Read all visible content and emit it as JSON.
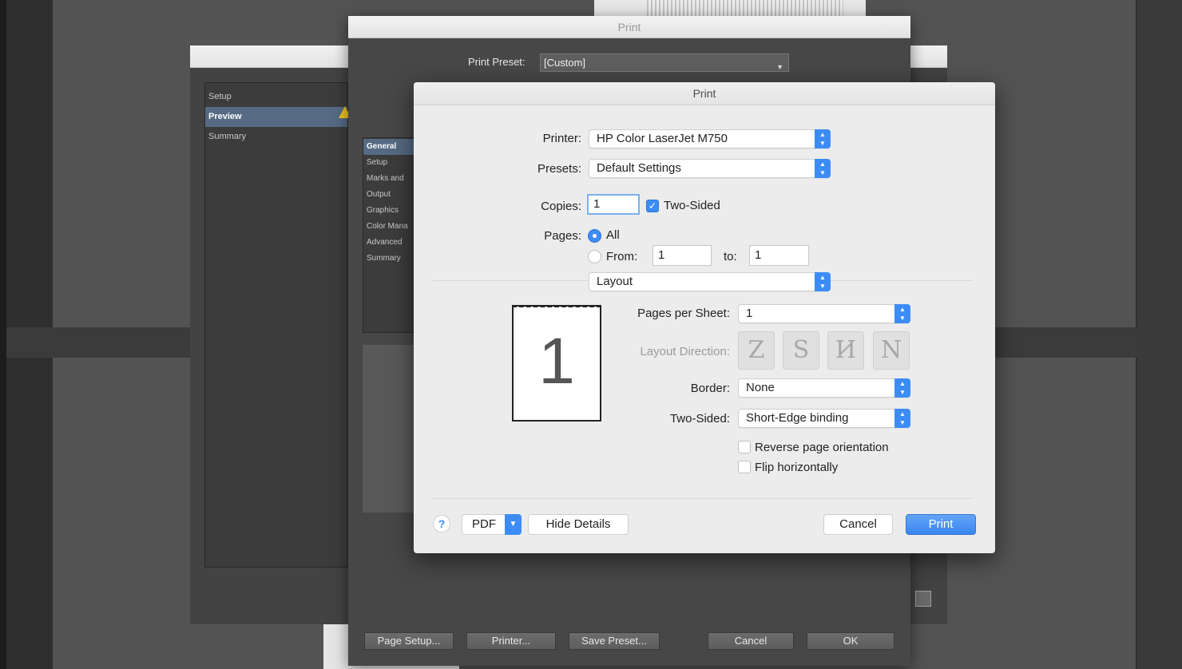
{
  "background_windows": {
    "booklet_sidebar": [
      {
        "label": "Setup",
        "selected": false
      },
      {
        "label": "Preview",
        "selected": true
      },
      {
        "label": "Summary",
        "selected": false
      }
    ],
    "indesign_print": {
      "title": "Print",
      "preset_label": "Print Preset:",
      "preset_value": "[Custom]",
      "sidebar": [
        {
          "label": "General",
          "selected": true
        },
        {
          "label": "Setup",
          "selected": false
        },
        {
          "label": "Marks and",
          "selected": false
        },
        {
          "label": "Output",
          "selected": false
        },
        {
          "label": "Graphics",
          "selected": false
        },
        {
          "label": "Color Mana",
          "selected": false
        },
        {
          "label": "Advanced",
          "selected": false
        },
        {
          "label": "Summary",
          "selected": false
        }
      ],
      "buttons": {
        "page_setup": "Page Setup...",
        "printer": "Printer...",
        "save_preset": "Save Preset...",
        "cancel": "Cancel",
        "ok": "OK"
      }
    }
  },
  "print_sheet": {
    "title": "Print",
    "printer_label": "Printer:",
    "printer_value": "HP Color LaserJet M750",
    "presets_label": "Presets:",
    "presets_value": "Default Settings",
    "copies_label": "Copies:",
    "copies_value": "1",
    "two_sided_check_label": "Two-Sided",
    "two_sided_checked": true,
    "pages_label": "Pages:",
    "pages_all_label": "All",
    "pages_from_label": "From:",
    "pages_from_value": "1",
    "pages_to_label": "to:",
    "pages_to_value": "1",
    "section_value": "Layout",
    "thumb_number": "1",
    "pages_per_sheet_label": "Pages per Sheet:",
    "pages_per_sheet_value": "1",
    "layout_direction_label": "Layout Direction:",
    "layout_direction_glyphs": [
      "Z",
      "S",
      "И",
      "N"
    ],
    "border_label": "Border:",
    "border_value": "None",
    "two_sided_label": "Two-Sided:",
    "two_sided_value": "Short-Edge binding",
    "reverse_orientation_label": "Reverse page orientation",
    "flip_horizontally_label": "Flip horizontally",
    "help_glyph": "?",
    "pdf_label": "PDF",
    "hide_details_label": "Hide Details",
    "cancel_label": "Cancel",
    "print_label": "Print"
  },
  "colors": {
    "accent": "#3d8cf5",
    "selection_dark": "#566a84",
    "warning": "#f0c419"
  }
}
